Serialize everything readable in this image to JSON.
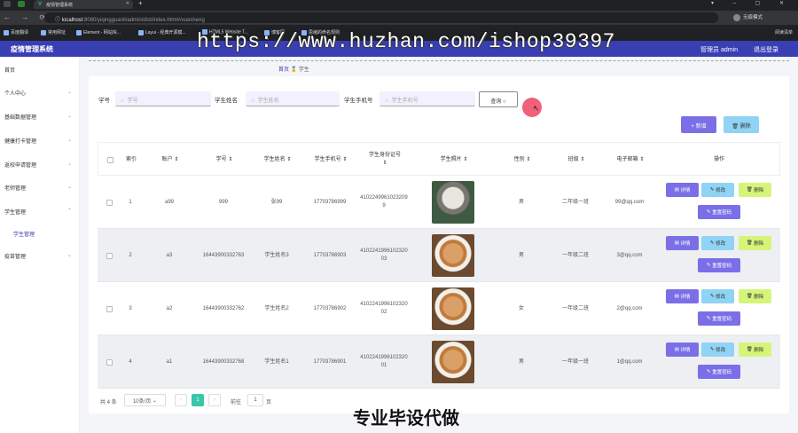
{
  "browser": {
    "tab_title": "疫情管理系统",
    "url_host": "localhost",
    "url_path": ":8080/yiqingguanli/admin/dist/index.html#/xuesheng",
    "profile": "无痕模式",
    "bookmarks": [
      "百度翻译",
      "常用网址",
      "Element - 网站快...",
      "Layui - 经典开源模...",
      "HTML5 Website T...",
      "博客园",
      "思绪的命名规则"
    ],
    "bookmarks_right": "阅读清单"
  },
  "watermark": "https://www.huzhan.com/ishop39397",
  "caption": "专业毕设代做",
  "app": {
    "title": "疫情管理系统",
    "admin": "管理员 admin",
    "logout": "退出登录"
  },
  "sidebar": {
    "items": [
      {
        "label": "首页",
        "arrow": false
      },
      {
        "label": "个人中心",
        "arrow": true
      },
      {
        "label": "基础数据管理",
        "arrow": true
      },
      {
        "label": "健康打卡管理",
        "arrow": true
      },
      {
        "label": "返校申请管理",
        "arrow": true
      },
      {
        "label": "老师管理",
        "arrow": true
      },
      {
        "label": "学生管理",
        "arrow": true
      },
      {
        "label": "疫苗管理",
        "arrow": true
      }
    ],
    "sub_item": "学生管理"
  },
  "breadcrumb": {
    "home": "首页",
    "current": "学生"
  },
  "search": {
    "fields": [
      {
        "label": "学号",
        "placeholder": "学号"
      },
      {
        "label": "学生姓名",
        "placeholder": "学生姓名"
      },
      {
        "label": "学生手机号",
        "placeholder": "学生手机号"
      }
    ],
    "button": "查询"
  },
  "actions": {
    "add": "+ 新增",
    "delete": "删除"
  },
  "table": {
    "headers": [
      "索引",
      "账户",
      "学号",
      "学生姓名",
      "学生手机号",
      "学生身份证号",
      "学生照片",
      "性别",
      "班级",
      "电子邮箱",
      "操作"
    ],
    "rows": [
      {
        "index": "1",
        "account": "a99",
        "student_no": "999",
        "name": "张99",
        "phone": "17703786999",
        "id_card": "41022499610232099",
        "gender": "男",
        "class": "二年级一班",
        "email": "99@qq.com"
      },
      {
        "index": "2",
        "account": "a3",
        "student_no": "16443900332763",
        "name": "学生姓名3",
        "phone": "17703786903",
        "id_card": "410224199610232003",
        "gender": "男",
        "class": "一年级二班",
        "email": "3@qq.com"
      },
      {
        "index": "3",
        "account": "a2",
        "student_no": "16443900332762",
        "name": "学生姓名2",
        "phone": "17703786902",
        "id_card": "410224199610232002",
        "gender": "女",
        "class": "一年级二班",
        "email": "2@qq.com"
      },
      {
        "index": "4",
        "account": "a1",
        "student_no": "16443900332768",
        "name": "学生姓名1",
        "phone": "17703786901",
        "id_card": "410224199610232001",
        "gender": "男",
        "class": "一年级一班",
        "email": "1@qq.com"
      }
    ],
    "row_buttons": {
      "detail": "详情",
      "edit": "修改",
      "delete": "删除",
      "reset": "重置密码"
    }
  },
  "pagination": {
    "total": "共 4 条",
    "page_size": "10条/页",
    "page": "1",
    "goto_label": "前往",
    "goto_value": "1",
    "goto_suffix": "页"
  }
}
